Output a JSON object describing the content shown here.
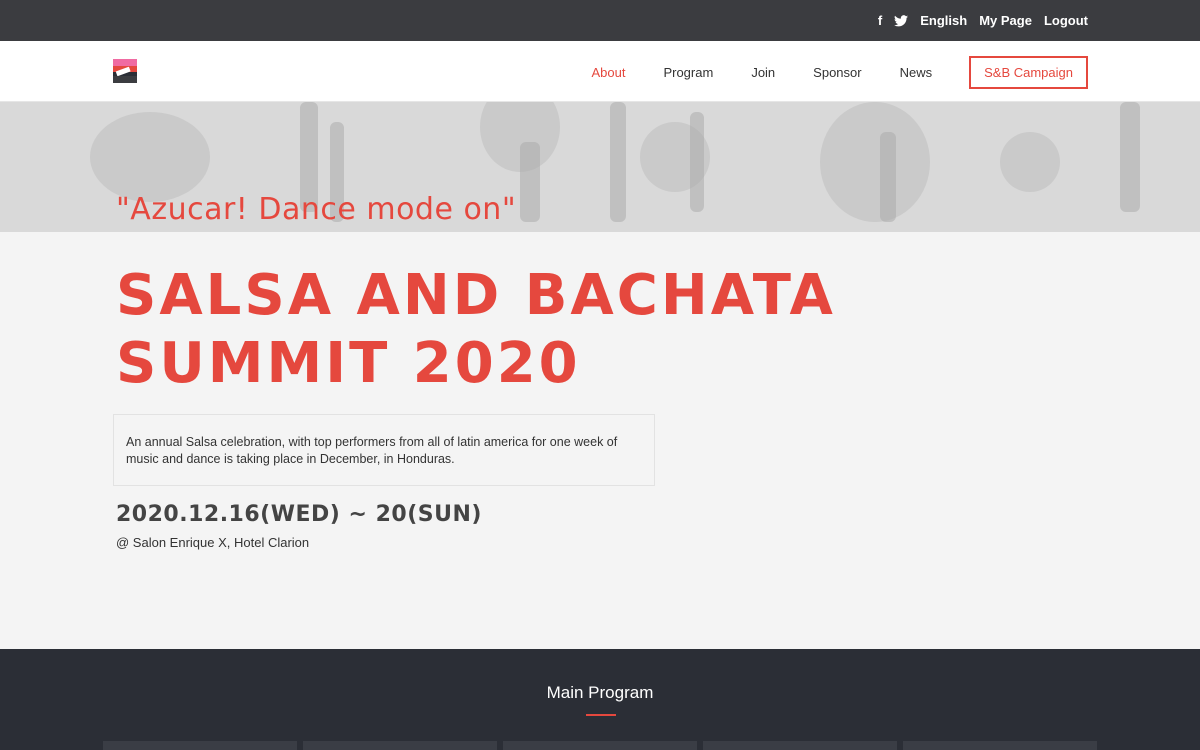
{
  "topbar": {
    "facebook_icon": "facebook-icon",
    "twitter_icon": "twitter-icon",
    "language": "English",
    "my_page": "My Page",
    "logout": "Logout"
  },
  "nav": {
    "items": [
      "About",
      "Program",
      "Join",
      "Sponsor",
      "News"
    ],
    "campaign": "S&B Campaign",
    "active_index": 0
  },
  "hero": {
    "tagline": "\"Azucar! Dance mode on\"",
    "title": "SALSA AND BACHATA SUMMIT 2020",
    "description": "An annual Salsa celebration, with top performers from all of latin america for one week of music and dance is taking place in December, in Honduras.",
    "date": "2020.12.16(WED) ~ 20(SUN)",
    "venue": "@ Salon Enrique X, Hotel Clarion"
  },
  "main_program": {
    "title": "Main Program"
  },
  "colors": {
    "accent": "#e5483e",
    "topbar": "#3b3c40",
    "dark_section": "#2b2e36",
    "page_bg": "#f4f4f4"
  }
}
